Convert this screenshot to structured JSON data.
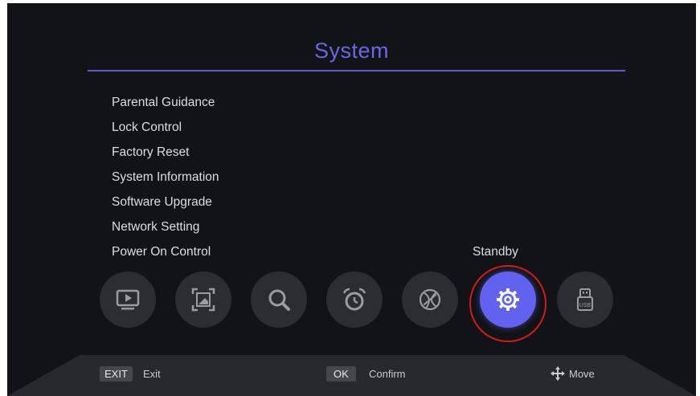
{
  "header": {
    "title": "System"
  },
  "menu": {
    "items": [
      {
        "label": "Parental Guidance",
        "value": ""
      },
      {
        "label": "Lock Control",
        "value": ""
      },
      {
        "label": "Factory Reset",
        "value": ""
      },
      {
        "label": "System Information",
        "value": ""
      },
      {
        "label": "Software Upgrade",
        "value": ""
      },
      {
        "label": "Network Setting",
        "value": ""
      },
      {
        "label": "Power On Control",
        "value": "Standby"
      }
    ]
  },
  "icon_bar": {
    "items": [
      {
        "icon": "tv-icon",
        "selected": false
      },
      {
        "icon": "picture-icon",
        "selected": false
      },
      {
        "icon": "search-icon",
        "selected": false
      },
      {
        "icon": "alarm-clock-icon",
        "selected": false
      },
      {
        "icon": "globe-icon",
        "selected": false
      },
      {
        "icon": "gear-icon",
        "selected": true
      },
      {
        "icon": "usb-icon",
        "selected": false
      }
    ],
    "usb_text": "USB"
  },
  "footer": {
    "exit_key": "EXIT",
    "exit_label": "Exit",
    "ok_key": "OK",
    "ok_label": "Confirm",
    "move_label": "Move"
  },
  "colors": {
    "accent": "#6a66e6",
    "selected_icon_bg": "#6262f0",
    "highlight_ring": "#d41a1a",
    "background": "#121316"
  }
}
